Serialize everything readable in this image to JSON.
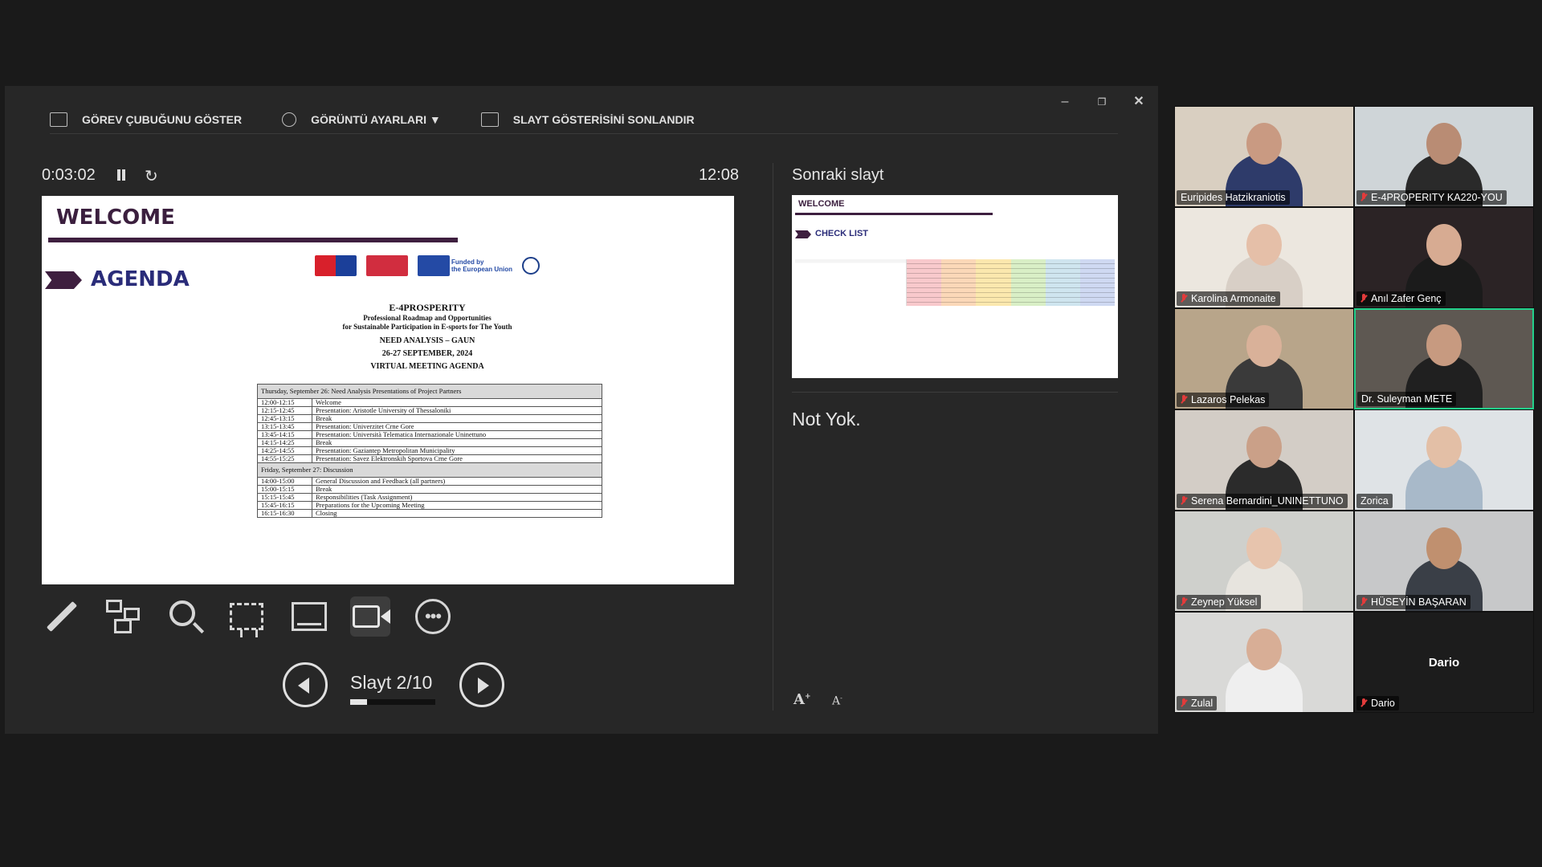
{
  "window": {
    "minimize_icon": "minimize-icon",
    "restore_icon": "restore-icon",
    "close_icon": "close-icon"
  },
  "toolbar": {
    "show_taskbar": "GÖREV ÇUBUĞUNU GÖSTER",
    "display_settings": "GÖRÜNTÜ AYARLARI ▼",
    "end_show": "SLAYT GÖSTERİSİNİ SONLANDIR"
  },
  "presenter": {
    "timer": "0:03:02",
    "clock": "12:08",
    "slide_counter": "Slayt 2/10",
    "progress_fraction": 0.2,
    "next_slide_label": "Sonraki slayt",
    "notes": "Not Yok."
  },
  "current_slide": {
    "title": "WELCOME",
    "subtitle": "AGENDA",
    "funded_by": "Funded by",
    "funded_by_2": "the European Union",
    "doc": {
      "project": "E-4PROSPERITY",
      "line1": "Professional Roadmap and Opportunities",
      "line2": "for Sustainable Participation in E-sports for The Youth",
      "line3": "NEED ANALYSIS – GAUN",
      "line4": "26-27 SEPTEMBER, 2024",
      "line5": "VIRTUAL MEETING AGENDA"
    },
    "day1_header": "Thursday, September 26: Need Analysis Presentations of Project Partners",
    "day1": [
      {
        "time": "12:00-12:15",
        "item": "Welcome"
      },
      {
        "time": "12:15-12:45",
        "item": "Presentation: Aristotle University of Thessaloniki"
      },
      {
        "time": "12:45-13:15",
        "item": "Break"
      },
      {
        "time": "13:15-13:45",
        "item": "Presentation: Univerzitet Crne Gore"
      },
      {
        "time": "13:45-14:15",
        "item": "Presentation: Università Telematica Internazionale Uninettuno"
      },
      {
        "time": "14:15-14:25",
        "item": "Break"
      },
      {
        "time": "14:25-14:55",
        "item": "Presentation: Gaziantep Metropolitan Municipality"
      },
      {
        "time": "14:55-15:25",
        "item": "Presentation: Savez Elektronskih Sportova Crne Gore"
      }
    ],
    "day2_header": "Friday, September 27: Discussion",
    "day2": [
      {
        "time": "14:00-15:00",
        "item": "General Discussion and Feedback (all partners)"
      },
      {
        "time": "15:00-15:15",
        "item": "Break"
      },
      {
        "time": "15:15-15:45",
        "item": "Responsibilities (Task Assignment)"
      },
      {
        "time": "15:45-16:15",
        "item": "Preparations for the Upcoming Meeting"
      },
      {
        "time": "16:15-16:30",
        "item": "Closing"
      }
    ]
  },
  "next_slide": {
    "title": "WELCOME",
    "subtitle": "CHECK LIST"
  },
  "tools": [
    "pen-icon",
    "slides-grid-icon",
    "zoom-icon",
    "laser-pointer-icon",
    "subtitles-icon",
    "camera-icon",
    "more-options-icon"
  ],
  "participants": [
    {
      "name": "Euripides Hatzikraniotis",
      "muted": false,
      "video": true,
      "bg": "#d9cfc1",
      "skin": "#c99a82",
      "shirt": "#2e3b6a"
    },
    {
      "name": "E-4PROPERITY KA220-YOU",
      "muted": true,
      "video": true,
      "bg": "#cfd5d8",
      "skin": "#b98c74",
      "shirt": "#2a2a2a"
    },
    {
      "name": "Karolina Armonaite",
      "muted": true,
      "video": true,
      "bg": "#ece7df",
      "skin": "#e5bfa8",
      "shirt": "#d8cfc6"
    },
    {
      "name": "Anıl Zafer Genç",
      "muted": true,
      "video": true,
      "bg": "#2b2325",
      "skin": "#d7ab92",
      "shirt": "#1b1b1b"
    },
    {
      "name": "Lazaros Pelekas",
      "muted": true,
      "video": true,
      "bg": "#b8a58a",
      "skin": "#d9b199",
      "shirt": "#3a3a3a"
    },
    {
      "name": "Dr. Suleyman METE",
      "muted": false,
      "video": true,
      "speaking": true,
      "bg": "#5e5852",
      "skin": "#c79a80",
      "shirt": "#202020"
    },
    {
      "name": "Serena Bernardini_UNINETTUNO",
      "muted": true,
      "video": true,
      "bg": "#d3cdc6",
      "skin": "#caa088",
      "shirt": "#2b2b2b"
    },
    {
      "name": "Zorica",
      "muted": false,
      "video": true,
      "bg": "#dfe3e6",
      "skin": "#e3bfa6",
      "shirt": "#a8b9c9"
    },
    {
      "name": "Zeynep Yüksel",
      "muted": true,
      "video": true,
      "bg": "#cfd0cc",
      "skin": "#e7c4ad",
      "shirt": "#e7e4de"
    },
    {
      "name": "HÜSEYİN BAŞARAN",
      "muted": true,
      "video": true,
      "bg": "#c7c8c9",
      "skin": "#c0906f",
      "shirt": "#3a3f47"
    },
    {
      "name": "Zulal",
      "muted": true,
      "video": true,
      "bg": "#d9d9d7",
      "skin": "#d8ae96",
      "shirt": "#efefef"
    },
    {
      "name": "Dario",
      "muted": true,
      "video": false,
      "bg": "#1c1c1c"
    }
  ]
}
